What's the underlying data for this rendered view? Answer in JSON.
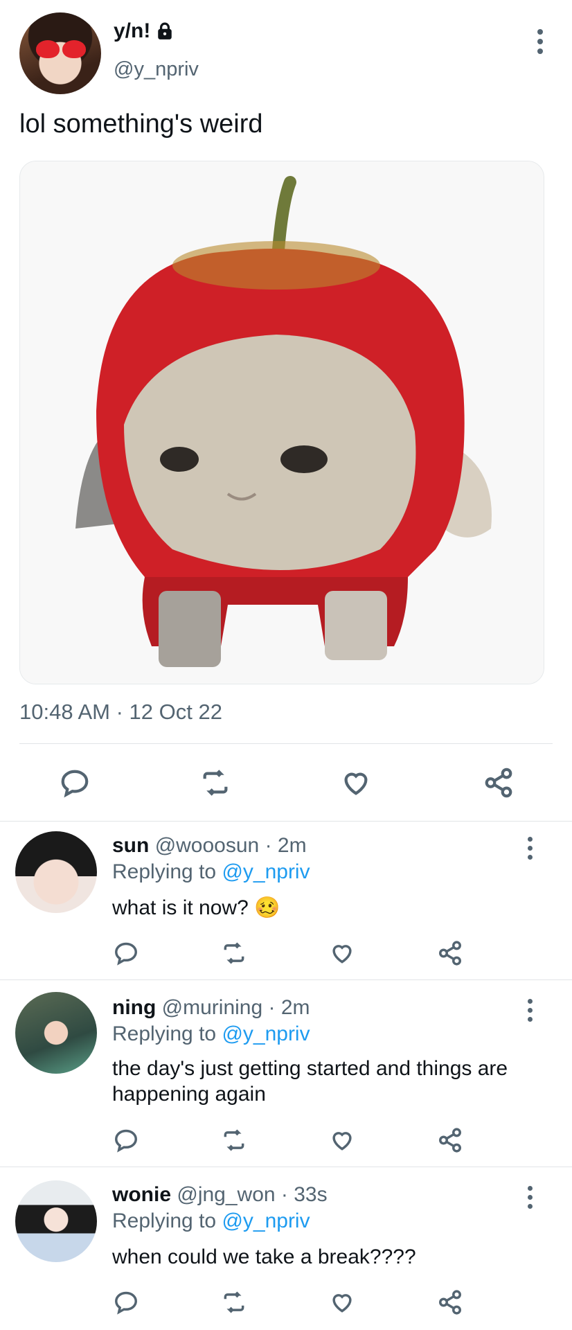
{
  "tweet": {
    "name": "y/n!",
    "handle": "@y_npriv",
    "text": "lol something's weird",
    "timestamp": "10:48 AM · 12 Oct 22",
    "lock_icon": "lock-icon",
    "media_icon": "apple-cat-image"
  },
  "replies": [
    {
      "name": "sun",
      "handle": "@wooosun",
      "time": "· 2m",
      "replying_prefix": "Replying to ",
      "replying_to": "@y_npriv",
      "text": "what is it now? 🥴"
    },
    {
      "name": "ning",
      "handle": "@murining",
      "time": "· 2m",
      "replying_prefix": "Replying to ",
      "replying_to": "@y_npriv",
      "text": "the day's just getting started and things are happening again"
    },
    {
      "name": "wonie",
      "handle": "@jng_won",
      "time": "· 33s",
      "replying_prefix": "Replying to ",
      "replying_to": "@y_npriv",
      "text": "when could we take a break????"
    }
  ],
  "icons": [
    "reply-icon",
    "retweet-icon",
    "like-icon",
    "share-icon",
    "more-options-icon"
  ],
  "colors": {
    "text": "#0f1419",
    "muted": "#536471",
    "link": "#1d9bf0",
    "divider": "#e1e4e7"
  }
}
